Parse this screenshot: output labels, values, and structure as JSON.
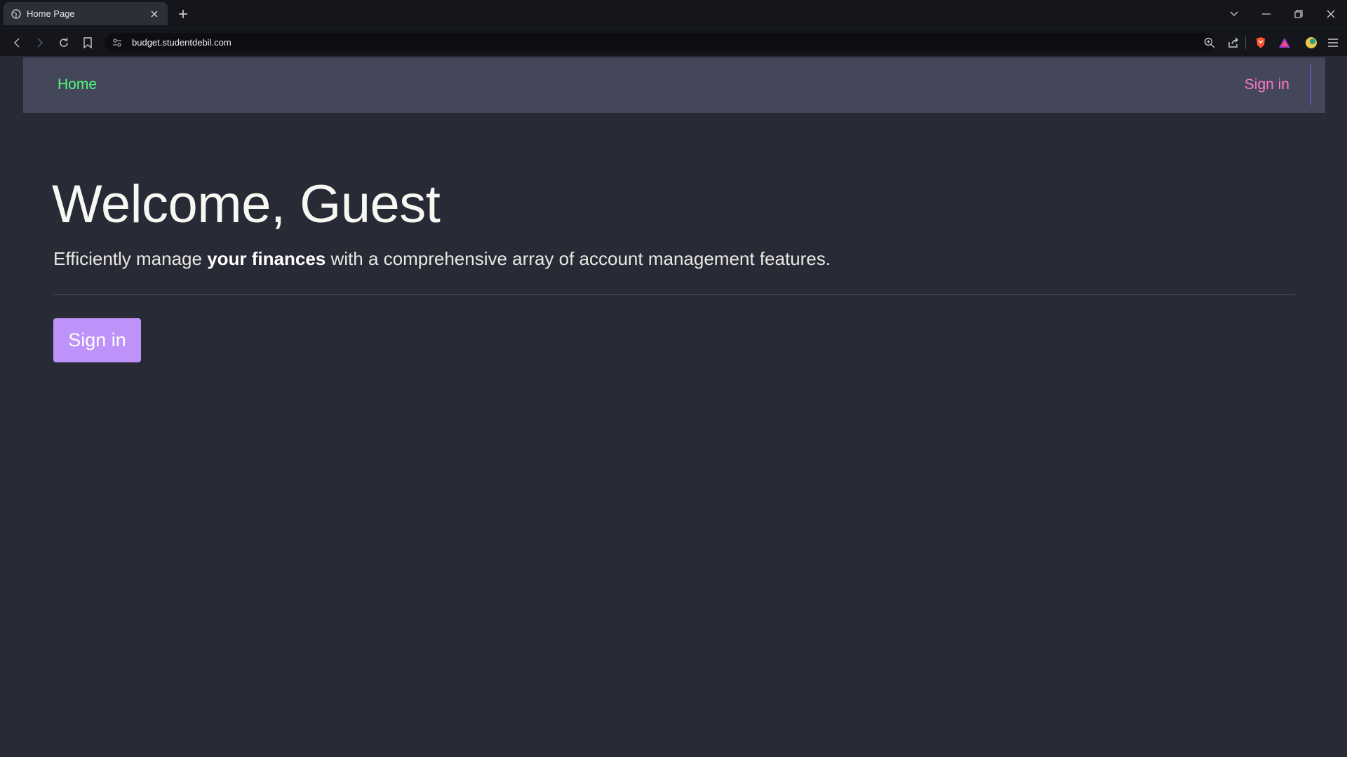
{
  "browser": {
    "tab": {
      "title": "Home Page"
    },
    "address_bar": {
      "url": "budget.studentdebil.com"
    }
  },
  "page": {
    "navbar": {
      "home_label": "Home",
      "signin_label": "Sign in"
    },
    "hero": {
      "title": "Welcome, Guest",
      "lead_before": "Efficiently manage ",
      "lead_bold": "your finances",
      "lead_after": " with a comprehensive array of account management features.",
      "button_label": "Sign in"
    }
  },
  "colors": {
    "background": "#282a36",
    "navbar": "#44475a",
    "home_link": "#50fa7b",
    "signin_link": "#ff79c6",
    "button": "#bd93f9"
  },
  "icons": [
    "globe-icon",
    "close-icon",
    "plus-icon",
    "chevron-down-icon",
    "minimize-icon",
    "restore-icon",
    "back-icon",
    "forward-icon",
    "reload-icon",
    "bookmark-icon",
    "site-settings-icon",
    "zoom-icon",
    "share-icon",
    "brave-shield-icon",
    "rewards-icon",
    "wallet-icon",
    "menu-icon"
  ]
}
